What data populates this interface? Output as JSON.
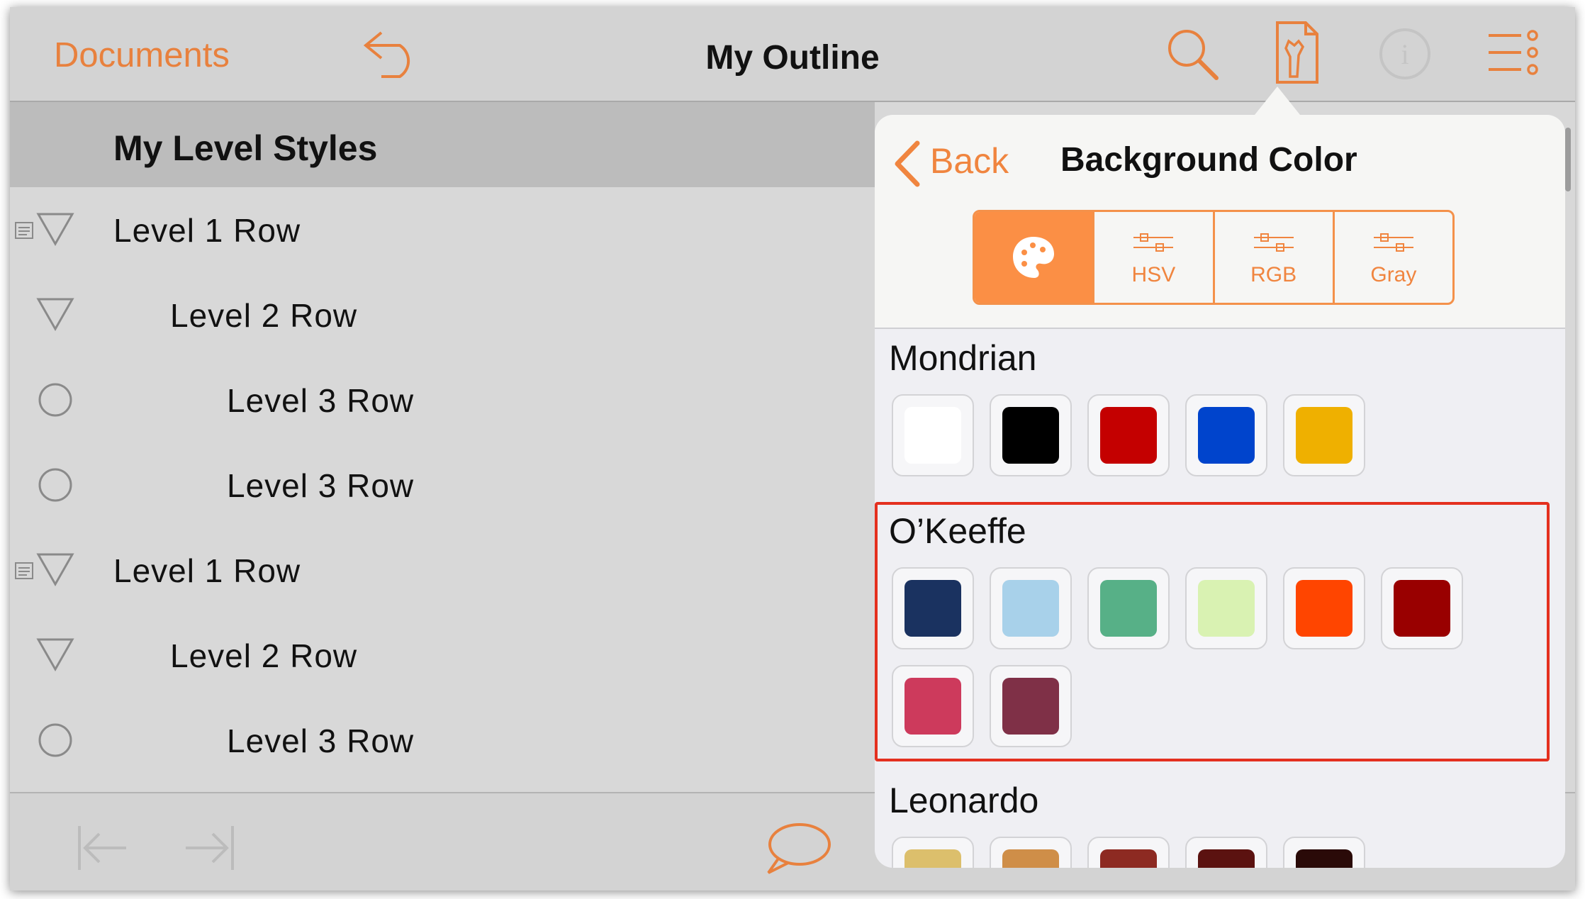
{
  "nav": {
    "documents_label": "Documents",
    "title": "My Outline",
    "icons": [
      "undo-icon",
      "search-icon",
      "inspector-icon",
      "info-icon",
      "list-icon"
    ]
  },
  "outline": {
    "section_title": "My Level Styles",
    "rows": [
      {
        "label": "Level 1 Row",
        "level": 1,
        "handle": "triangle",
        "has_note": true
      },
      {
        "label": "Level 2 Row",
        "level": 2,
        "handle": "triangle",
        "has_note": false
      },
      {
        "label": "Level 3 Row",
        "level": 3,
        "handle": "circle",
        "has_note": false
      },
      {
        "label": "Level 3 Row",
        "level": 3,
        "handle": "circle",
        "has_note": false
      },
      {
        "label": "Level 1 Row",
        "level": 1,
        "handle": "triangle",
        "has_note": true
      },
      {
        "label": "Level 2 Row",
        "level": 2,
        "handle": "triangle",
        "has_note": false
      },
      {
        "label": "Level 3 Row",
        "level": 3,
        "handle": "circle",
        "has_note": false
      }
    ]
  },
  "toolbar": {
    "icons": [
      "outdent-icon",
      "indent-icon",
      "comment-icon"
    ]
  },
  "popover": {
    "back_label": "Back",
    "title": "Background Color",
    "segments": [
      {
        "label": "",
        "icon": "palette-icon",
        "selected": true
      },
      {
        "label": "HSV",
        "icon": "slider-icon",
        "selected": false
      },
      {
        "label": "RGB",
        "icon": "slider-icon",
        "selected": false
      },
      {
        "label": "Gray",
        "icon": "slider-icon",
        "selected": false
      }
    ],
    "groups": [
      {
        "name": "Mondrian",
        "colors": [
          "#ffffff",
          "#000000",
          "#c40000",
          "#0044cc",
          "#efb000"
        ]
      },
      {
        "name": "O’Keeffe",
        "colors": [
          "#1a3260",
          "#a8d1ea",
          "#57b087",
          "#d9f2b2",
          "#ff4500",
          "#990000",
          "#cd3a5c",
          "#7f3047"
        ],
        "highlighted": true
      },
      {
        "name": "Leonardo",
        "colors": [
          "#dcbf6c",
          "#cf8e48",
          "#8d2a22",
          "#5b1210",
          "#2a0a08"
        ]
      }
    ]
  },
  "colors": {
    "accent": "#e8813e",
    "highlight_border": "#e4301f"
  }
}
